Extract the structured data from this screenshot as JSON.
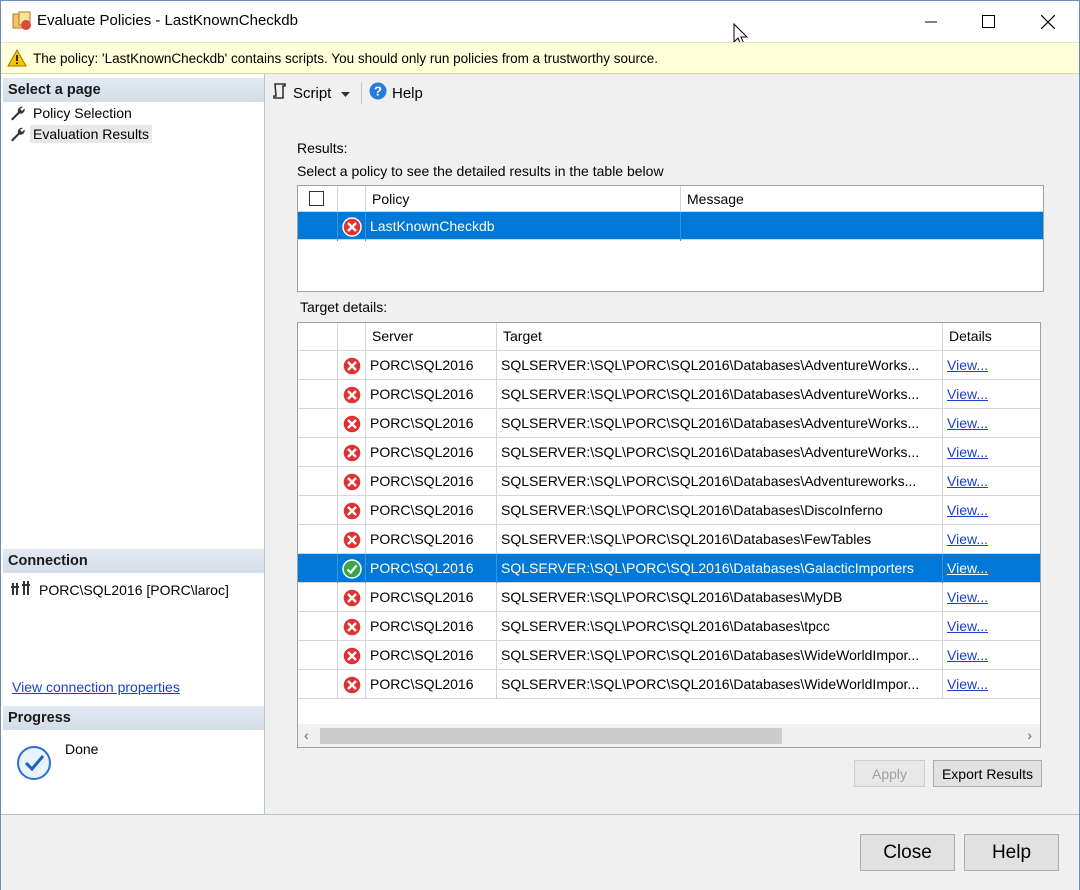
{
  "window": {
    "title": "Evaluate Policies - LastKnownCheckdb"
  },
  "warning": {
    "text": "The policy: 'LastKnownCheckdb' contains scripts. You should only run policies from a trustworthy source."
  },
  "left": {
    "select_page_header": "Select a page",
    "pages": [
      {
        "label": "Policy Selection"
      },
      {
        "label": "Evaluation Results"
      }
    ],
    "connection_header": "Connection",
    "connection_text": "PORC\\SQL2016 [PORC\\laroc]",
    "view_connection_link": "View connection properties",
    "progress_header": "Progress",
    "progress_status": "Done"
  },
  "toolbar": {
    "script_label": "Script",
    "help_label": "Help"
  },
  "results": {
    "label": "Results:",
    "instruction": "Select a policy to see the detailed results in the table below",
    "columns": {
      "policy": "Policy",
      "message": "Message"
    },
    "rows": [
      {
        "policy": "LastKnownCheckdb",
        "message": "",
        "status": "fail"
      }
    ]
  },
  "target_details": {
    "label": "Target details:",
    "columns": {
      "server": "Server",
      "target": "Target",
      "details": "Details"
    },
    "rows": [
      {
        "server": "PORC\\SQL2016",
        "target": "SQLSERVER:\\SQL\\PORC\\SQL2016\\Databases\\AdventureWorks...",
        "details": "View...",
        "status": "fail"
      },
      {
        "server": "PORC\\SQL2016",
        "target": "SQLSERVER:\\SQL\\PORC\\SQL2016\\Databases\\AdventureWorks...",
        "details": "View...",
        "status": "fail"
      },
      {
        "server": "PORC\\SQL2016",
        "target": "SQLSERVER:\\SQL\\PORC\\SQL2016\\Databases\\AdventureWorks...",
        "details": "View...",
        "status": "fail"
      },
      {
        "server": "PORC\\SQL2016",
        "target": "SQLSERVER:\\SQL\\PORC\\SQL2016\\Databases\\AdventureWorks...",
        "details": "View...",
        "status": "fail"
      },
      {
        "server": "PORC\\SQL2016",
        "target": "SQLSERVER:\\SQL\\PORC\\SQL2016\\Databases\\Adventureworks...",
        "details": "View...",
        "status": "fail"
      },
      {
        "server": "PORC\\SQL2016",
        "target": "SQLSERVER:\\SQL\\PORC\\SQL2016\\Databases\\DiscoInferno",
        "details": "View...",
        "status": "fail"
      },
      {
        "server": "PORC\\SQL2016",
        "target": "SQLSERVER:\\SQL\\PORC\\SQL2016\\Databases\\FewTables",
        "details": "View...",
        "status": "fail"
      },
      {
        "server": "PORC\\SQL2016",
        "target": "SQLSERVER:\\SQL\\PORC\\SQL2016\\Databases\\GalacticImporters",
        "details": "View...",
        "status": "pass"
      },
      {
        "server": "PORC\\SQL2016",
        "target": "SQLSERVER:\\SQL\\PORC\\SQL2016\\Databases\\MyDB",
        "details": "View...",
        "status": "fail"
      },
      {
        "server": "PORC\\SQL2016",
        "target": "SQLSERVER:\\SQL\\PORC\\SQL2016\\Databases\\tpcc",
        "details": "View...",
        "status": "fail"
      },
      {
        "server": "PORC\\SQL2016",
        "target": "SQLSERVER:\\SQL\\PORC\\SQL2016\\Databases\\WideWorldImpor...",
        "details": "View...",
        "status": "fail"
      },
      {
        "server": "PORC\\SQL2016",
        "target": "SQLSERVER:\\SQL\\PORC\\SQL2016\\Databases\\WideWorldImpor...",
        "details": "View...",
        "status": "fail"
      }
    ]
  },
  "buttons": {
    "apply": "Apply",
    "export": "Export Results",
    "close": "Close",
    "help": "Help"
  },
  "colors": {
    "selection": "#0078d7",
    "fail": "#e0302f",
    "pass": "#3aa64a",
    "link": "#1a3fcb",
    "warning_bg": "#ffffd9"
  }
}
